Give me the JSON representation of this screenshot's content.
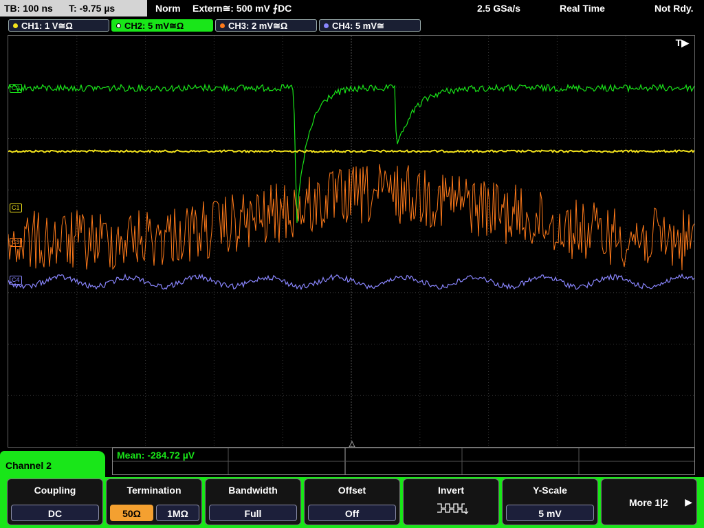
{
  "topbar": {
    "timebase": "TB: 100 ns",
    "trigger_time": "T: -9.75 µs",
    "mode": "Norm",
    "trigger_source": "Extern≅: 500 mV ⨍DC",
    "sample_rate": "2.5 GSa/s",
    "acquisition": "Real Time",
    "status": "Not Rdy."
  },
  "channels": [
    {
      "label": "CH1: 1 V≅Ω",
      "color": "#f2e21c"
    },
    {
      "label": "CH2: 5 mV≅Ω",
      "color": "#19e619"
    },
    {
      "label": "CH3: 2 mV≅Ω",
      "color": "#ff7a1a"
    },
    {
      "label": "CH4: 5 mV≅",
      "color": "#8a86ff"
    }
  ],
  "waveform_tags": {
    "c1": "C1",
    "c2": "C2",
    "c3": "C3",
    "c4": "C4"
  },
  "trigger_marker": "T▶",
  "measurement": {
    "mean": "Mean: -284.72 µV"
  },
  "menu_title": "Channel 2",
  "softkeys": {
    "coupling": {
      "title": "Coupling",
      "value": "DC"
    },
    "termination": {
      "title": "Termination",
      "opt1": "50Ω",
      "opt2": "1MΩ"
    },
    "bandwidth": {
      "title": "Bandwidth",
      "value": "Full"
    },
    "offset": {
      "title": "Offset",
      "value": "Off"
    },
    "invert": {
      "title": "Invert",
      "icon": "invert-waveform-icon"
    },
    "yscale": {
      "title": "Y-Scale",
      "value": "5 mV"
    },
    "more": {
      "label": "More 1|2"
    }
  }
}
